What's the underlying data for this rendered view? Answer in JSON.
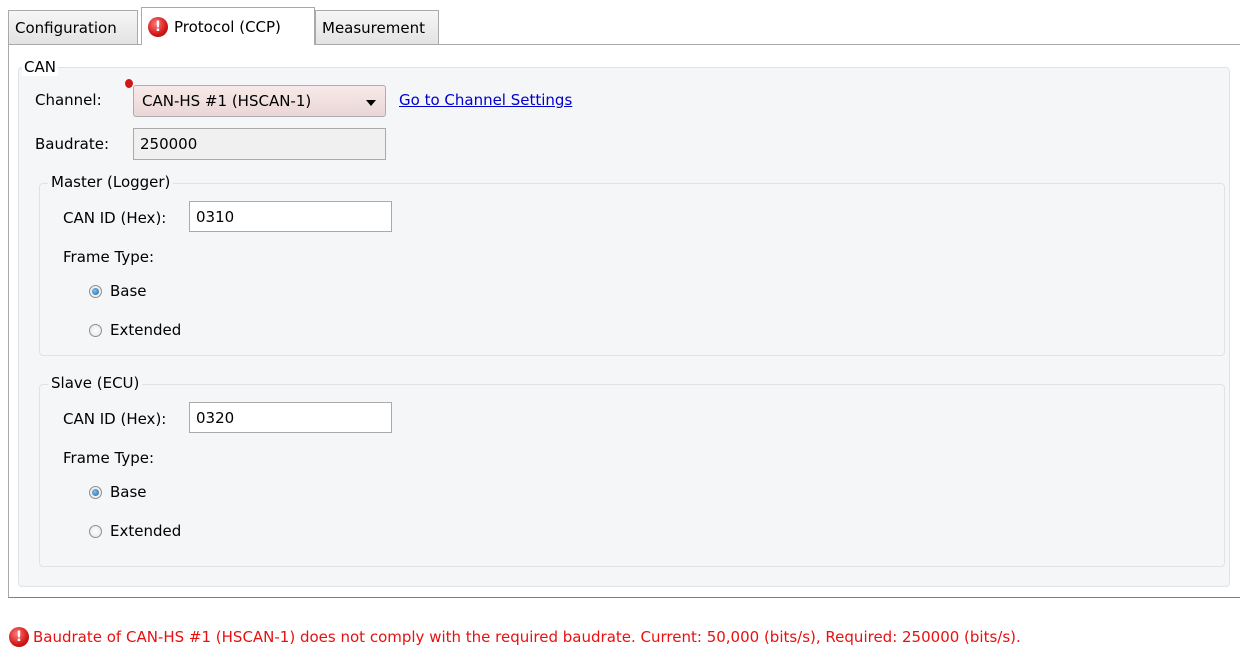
{
  "tabs": [
    {
      "label": "Configuration",
      "active": false
    },
    {
      "label": "Protocol (CCP)",
      "active": true,
      "error": true
    },
    {
      "label": "Measurement",
      "active": false
    }
  ],
  "can": {
    "title": "CAN",
    "channel_label": "Channel:",
    "channel_value": "CAN-HS #1 (HSCAN-1)",
    "channel_link": "Go to Channel Settings",
    "baudrate_label": "Baudrate:",
    "baudrate_value": "250000"
  },
  "master": {
    "title": "Master (Logger)",
    "can_id_label": "CAN ID (Hex):",
    "can_id_value": "0310",
    "frame_type_label": "Frame Type:",
    "frame_options": [
      {
        "label": "Base",
        "selected": true
      },
      {
        "label": "Extended",
        "selected": false
      }
    ]
  },
  "slave": {
    "title": "Slave (ECU)",
    "can_id_label": "CAN ID (Hex):",
    "can_id_value": "0320",
    "frame_type_label": "Frame Type:",
    "frame_options": [
      {
        "label": "Base",
        "selected": true
      },
      {
        "label": "Extended",
        "selected": false
      }
    ]
  },
  "status": {
    "message": "Baudrate of CAN-HS #1 (HSCAN-1) does not comply with the required baudrate. Current: 50,000 (bits/s), Required: 250000 (bits/s).",
    "icon": "error-icon",
    "color": "#e81010"
  },
  "colors": {
    "error_red": "#d11717",
    "link_blue": "#0000cc",
    "groupbox_bg": "#f5f6f7"
  }
}
